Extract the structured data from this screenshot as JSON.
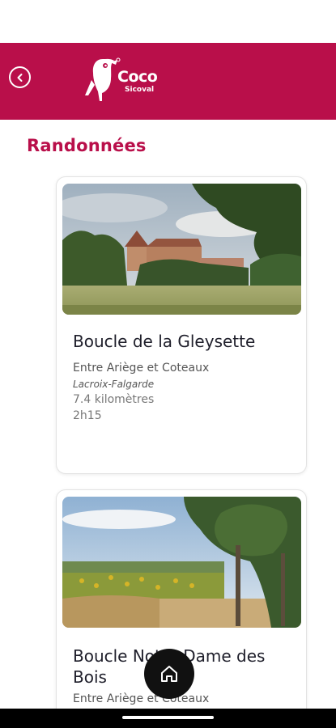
{
  "header": {
    "brand": "Coco",
    "brand_sub": "Sicoval",
    "accent_color": "#b90f4a",
    "back_icon": "chevron-left-circle-icon"
  },
  "page": {
    "title": "Randonnées"
  },
  "hikes": [
    {
      "title": "Boucle de la Gleysette",
      "region": "Entre Ariège et Coteaux",
      "town": "Lacroix-Falgarde",
      "distance": "7.4 kilomètres",
      "duration": "2h15",
      "image": "castle-field-photo"
    },
    {
      "title": "Boucle Notre-Dame des Bois",
      "region": "Entre Ariège et Coteaux",
      "image": "sunflower-field-photo"
    }
  ],
  "fab": {
    "icon": "home-icon"
  }
}
